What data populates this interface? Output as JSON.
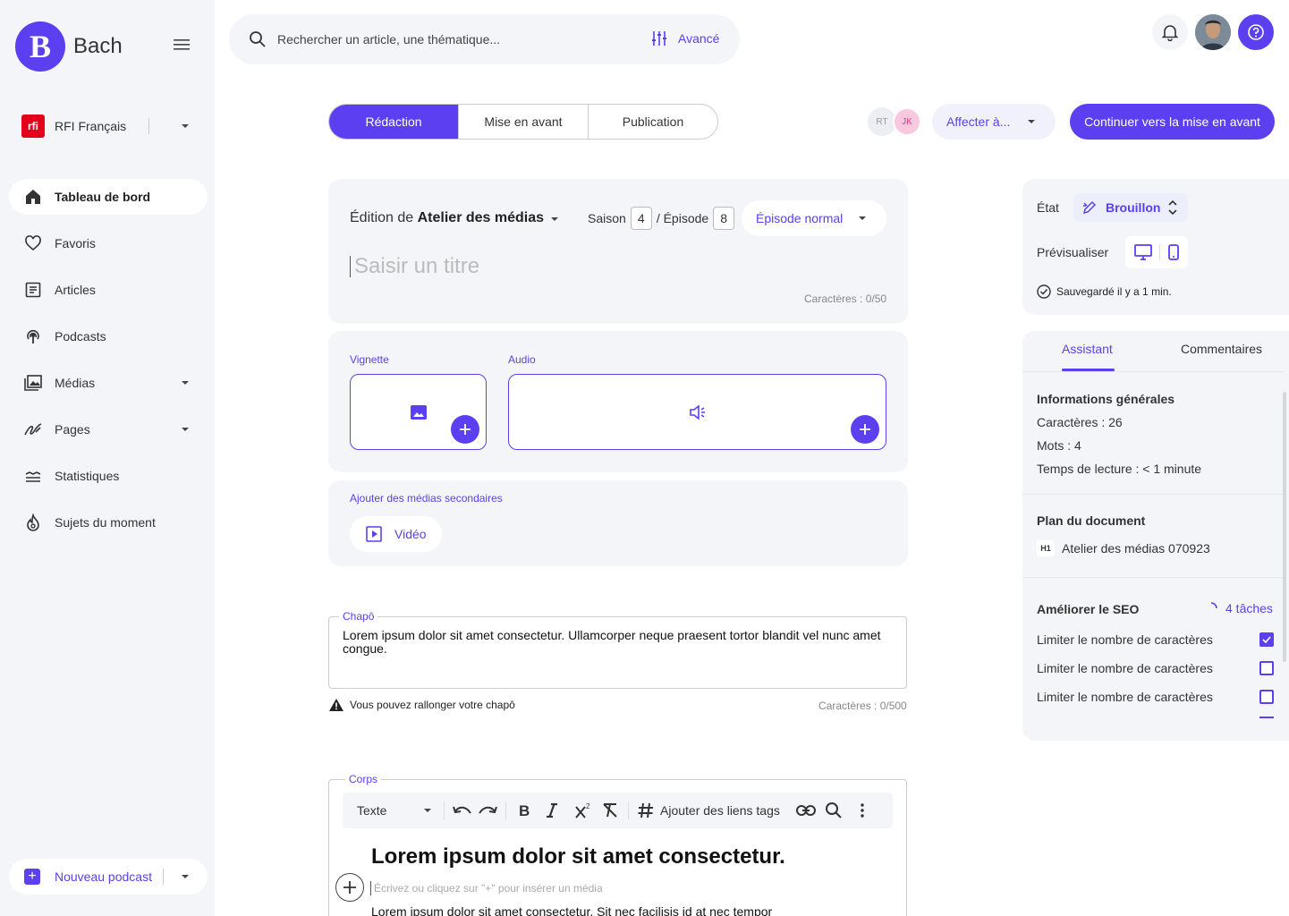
{
  "app": {
    "logo_letter": "B",
    "name": "Bach"
  },
  "org": {
    "name": "RFI Français",
    "logo_text": "rfi"
  },
  "sidebar": {
    "items": [
      {
        "label": "Tableau de bord"
      },
      {
        "label": "Favoris"
      },
      {
        "label": "Articles"
      },
      {
        "label": "Podcasts"
      },
      {
        "label": "Médias"
      },
      {
        "label": "Pages"
      },
      {
        "label": "Statistiques"
      },
      {
        "label": "Sujets du moment"
      }
    ],
    "new_podcast": "Nouveau podcast"
  },
  "search": {
    "placeholder": "Rechercher un article, une thématique...",
    "advanced": "Avancé"
  },
  "tabs": [
    {
      "label": "Rédaction"
    },
    {
      "label": "Mise en avant"
    },
    {
      "label": "Publication"
    }
  ],
  "assignees": [
    {
      "initials": "RT"
    },
    {
      "initials": "JK"
    }
  ],
  "assign_label": "Affecter à...",
  "continue_label": "Continuer vers la mise en avant",
  "episode": {
    "edition_prefix": "Édition de",
    "edition_name": "Atelier des médias",
    "saison_label": "Saison",
    "saison_value": "4",
    "episode_label": "/ Épisode",
    "episode_value": "8",
    "type": "Épisode normal",
    "title_placeholder": "Saisir un titre",
    "title_chars": "Caractères : 0/50"
  },
  "media": {
    "vignette_label": "Vignette",
    "audio_label": "Audio",
    "secondary_label": "Ajouter des médias secondaires",
    "video_label": "Vidéo"
  },
  "chapo": {
    "legend": "Chapô",
    "text": "Lorem ipsum dolor sit amet consectetur. Ullamcorper neque praesent tortor blandit vel nunc amet congue.",
    "warning": "Vous pouvez rallonger votre chapô",
    "chars": "Caractères : 0/500"
  },
  "corps": {
    "legend": "Corps",
    "format": "Texte",
    "tags_label": "Ajouter des liens tags",
    "heading": "Lorem ipsum dolor sit amet consectetur.",
    "hint": "Écrivez ou cliquez sur \"+\" pour insérer un média",
    "paragraph": "Lorem ipsum dolor sit amet consectetur. Sit nec facilisis id at nec tempor"
  },
  "status": {
    "state_label": "État",
    "state_value": "Brouillon",
    "preview_label": "Prévisualiser",
    "saved": "Sauvegardé il y a 1 min."
  },
  "panel": {
    "tab_assistant": "Assistant",
    "tab_comments": "Commentaires",
    "info_title": "Informations générales",
    "info_chars": "Caractères : 26",
    "info_words": "Mots : 4",
    "info_time": "Temps de lecture : < 1 minute",
    "plan_title": "Plan du document",
    "plan_tag": "H1",
    "plan_item": "Atelier des médias 070923",
    "seo_title": "Améliorer le SEO",
    "seo_tasks": "4 tâches",
    "seo_items": [
      {
        "label": "Limiter le nombre de caractères",
        "checked": true
      },
      {
        "label": "Limiter le nombre de caractères",
        "checked": false
      },
      {
        "label": "Limiter le nombre de caractères",
        "checked": false
      }
    ]
  },
  "colors": {
    "accent": "#5b3ff0",
    "surface": "#f4f5f9",
    "rfi_red": "#e2001a"
  }
}
